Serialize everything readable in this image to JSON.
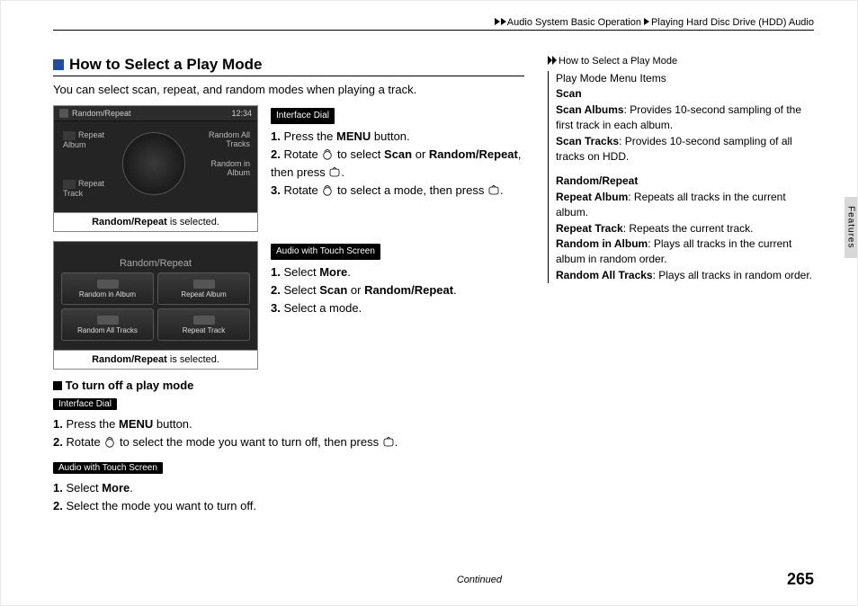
{
  "header": {
    "crumb1": "Audio System Basic Operation",
    "crumb2": "Playing Hard Disc Drive (HDD) Audio"
  },
  "section": {
    "title": "How to Select a Play Mode"
  },
  "intro": "You can select scan, repeat, and random modes when playing a track.",
  "shot1": {
    "title": "Random/Repeat",
    "time": "12:34",
    "labels": {
      "repeat_album": "Repeat Album",
      "repeat_track": "Repeat Track",
      "random_all": "Random All Tracks",
      "random_in": "Random in Album"
    },
    "caption_pre": "Random/Repeat",
    "caption_post": " is selected."
  },
  "shot2": {
    "title": "Random/Repeat",
    "tiles": {
      "ria": "Random in Album",
      "ra": "Repeat Album",
      "rat": "Random All Tracks",
      "rt": "Repeat Track"
    },
    "caption_pre": "Random/Repeat",
    "caption_post": " is selected."
  },
  "steps_dial": {
    "pill": "Interface Dial",
    "l1a": "1. ",
    "l1b": "Press the ",
    "l1c": "MENU",
    "l1d": " button.",
    "l2a": "2. ",
    "l2b": "Rotate ",
    "l2c": " to select ",
    "l2d": "Scan",
    "l2e": " or ",
    "l2f": "Random/Repeat",
    "l2g": ", then press ",
    "l2h": ".",
    "l3a": "3. ",
    "l3b": "Rotate ",
    "l3c": " to select a mode, then press ",
    "l3d": "."
  },
  "steps_touch": {
    "pill": "Audio with Touch Screen",
    "l1a": "1. ",
    "l1b": "Select ",
    "l1c": "More",
    "l1d": ".",
    "l2a": "2. ",
    "l2b": "Select ",
    "l2c": "Scan",
    "l2d": " or ",
    "l2e": "Random/Repeat",
    "l2f": ".",
    "l3a": "3. ",
    "l3b": "Select a mode."
  },
  "turn_off_head": "To turn off a play mode",
  "off_dial": {
    "pill": "Interface Dial",
    "l1a": "1. ",
    "l1b": "Press the ",
    "l1c": "MENU",
    "l1d": " button.",
    "l2a": "2. ",
    "l2b": "Rotate ",
    "l2c": " to select the mode you want to turn off, then press ",
    "l2d": "."
  },
  "off_touch": {
    "pill": "Audio with Touch Screen",
    "l1a": "1. ",
    "l1b": "Select ",
    "l1c": "More",
    "l1d": ".",
    "l2a": "2. ",
    "l2b": "Select the mode you want to turn off."
  },
  "side": {
    "head": "How to Select a Play Mode",
    "p1_title": "Play Mode Menu Items",
    "p1_b1": "Scan",
    "p1_b2": "Scan Albums",
    "p1_t2": ": Provides 10-second sampling of the first track in each album.",
    "p1_b3": "Scan Tracks",
    "p1_t3": ": Provides 10-second sampling of all tracks on HDD.",
    "p2_b1": "Random/Repeat",
    "p2_b2": "Repeat Album",
    "p2_t2": ": Repeats all tracks in the current album.",
    "p2_b3": "Repeat Track",
    "p2_t3": ": Repeats the current track.",
    "p2_b4": "Random in Album",
    "p2_t4": ": Plays all tracks in the current album in random order.",
    "p2_b5": "Random All Tracks",
    "p2_t5": ": Plays all tracks in random order."
  },
  "vtab": "Features",
  "continued": "Continued",
  "page_no": "265"
}
